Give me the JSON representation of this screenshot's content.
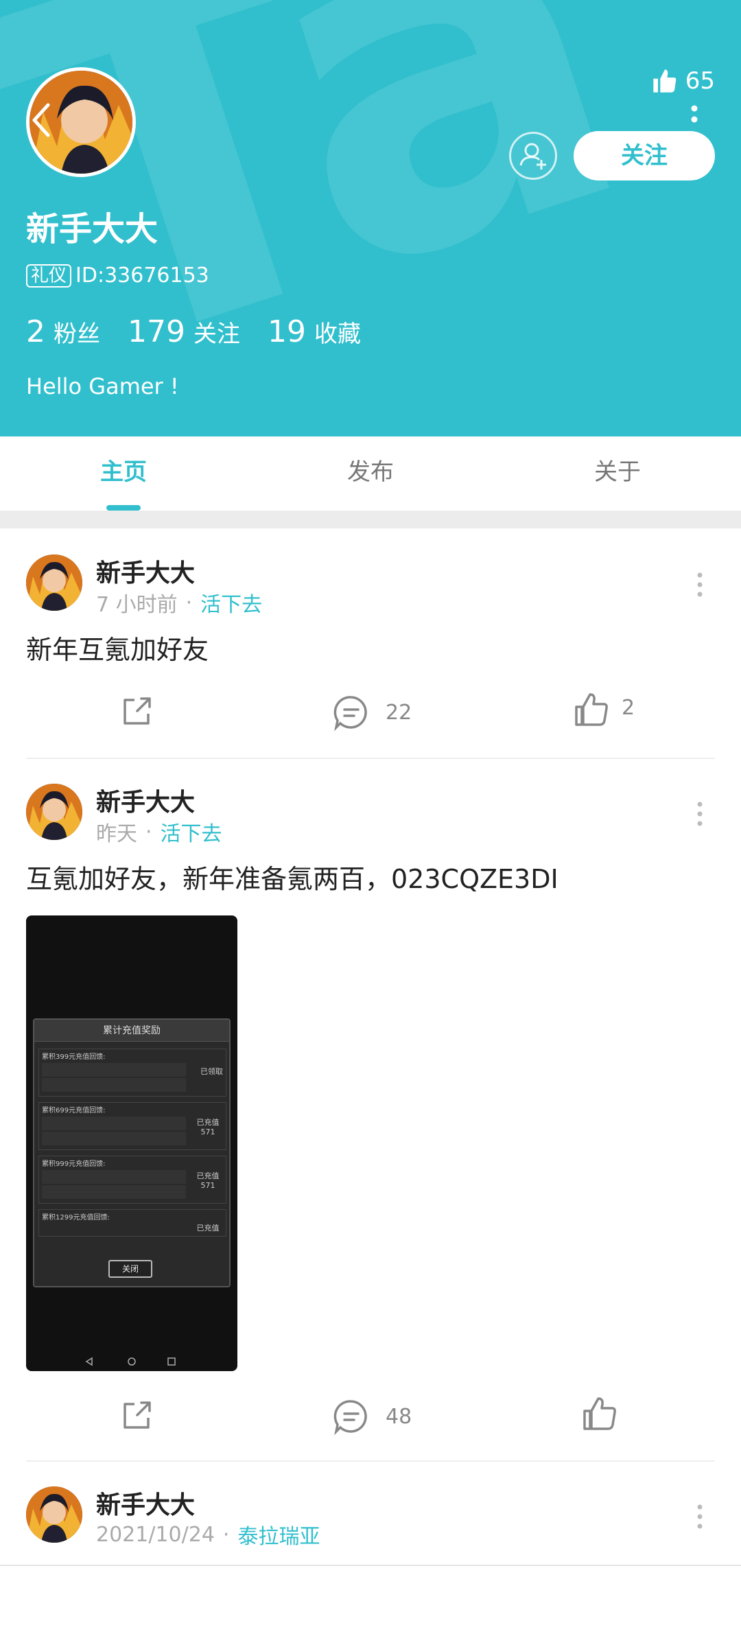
{
  "header": {
    "bg_color": "#31bfcd",
    "like_count": "65",
    "follow_label": "关注",
    "username": "新手大大",
    "id_tag": "礼仪",
    "id_text": "ID:33676153",
    "stats": [
      {
        "num": "2",
        "label": "粉丝"
      },
      {
        "num": "179",
        "label": "关注"
      },
      {
        "num": "19",
        "label": "收藏"
      }
    ],
    "bio": "Hello Gamer !"
  },
  "tabs": [
    {
      "label": "主页",
      "active": true
    },
    {
      "label": "发布",
      "active": false
    },
    {
      "label": "关于",
      "active": false
    }
  ],
  "posts": [
    {
      "author": "新手大大",
      "time": "7 小时前",
      "game": "活下去",
      "text": "新年互氪加好友",
      "comments": "22",
      "likes": "2"
    },
    {
      "author": "新手大大",
      "time": "昨天",
      "game": "活下去",
      "text": "互氪加好友，新年准备氪两百，023CQZE3DI",
      "comments": "48",
      "likes": ""
    },
    {
      "author": "新手大大",
      "time": "2021/10/24",
      "game": "泰拉瑞亚"
    }
  ],
  "screenshot_dialog": {
    "title": "累计充值奖励",
    "tiers": [
      {
        "label": "累积399元充值回馈:",
        "status": "已领取"
      },
      {
        "label": "累积699元充值回馈:",
        "status": "已充值 571"
      },
      {
        "label": "累积999元充值回馈:",
        "status": "已充值 571"
      },
      {
        "label": "累积1299元充值回馈:",
        "status": "已充值"
      }
    ],
    "close_label": "关闭"
  },
  "icons": {
    "like": "thumbs-up-icon",
    "share": "share-icon",
    "comment": "comment-icon",
    "more": "more-vertical-icon",
    "add_friend": "add-friend-icon",
    "back": "back-arrow-icon"
  },
  "accent_color": "#31bfcd"
}
